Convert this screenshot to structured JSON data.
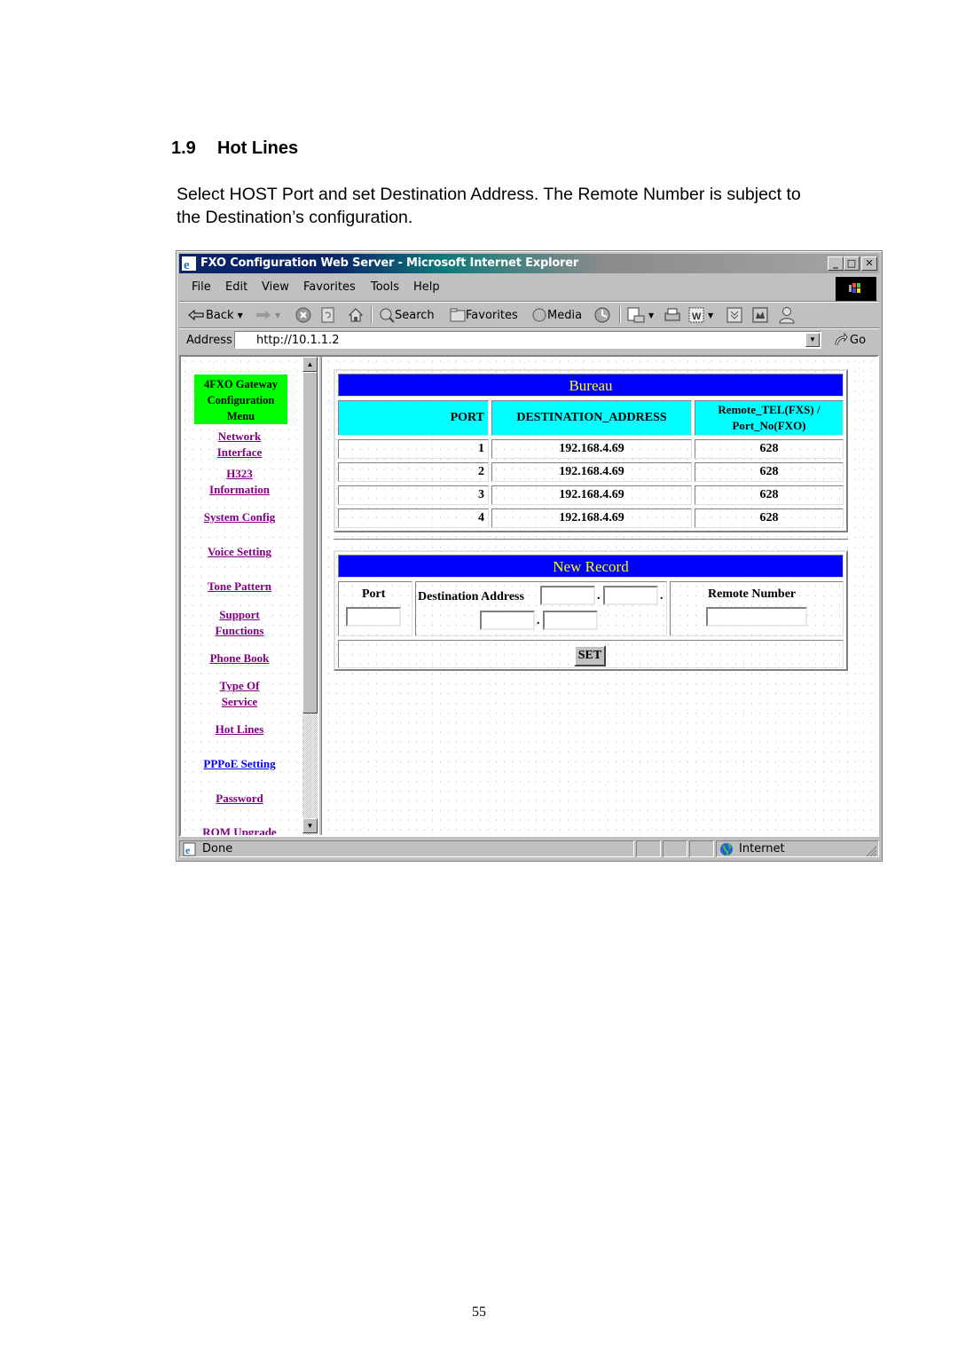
{
  "document": {
    "section_number": "1.9",
    "section_title": "Hot Lines",
    "paragraph": "Select HOST Port and set Destination Address. The Remote Number is subject to the Destination’s configuration.",
    "page_number": "55"
  },
  "browser": {
    "window_title": "FXO Configuration Web Server - Microsoft Internet Explorer",
    "window_controls": {
      "minimize": "_",
      "maximize": "□",
      "close": "✕"
    },
    "menu": [
      "File",
      "Edit",
      "View",
      "Favorites",
      "Tools",
      "Help"
    ],
    "toolbar": {
      "back": "Back",
      "search": "Search",
      "favorites": "Favorites",
      "media": "Media",
      "icons": [
        "back-arrow-icon",
        "forward-arrow-icon",
        "stop-icon",
        "refresh-icon",
        "home-icon",
        "search-icon",
        "favorites-icon",
        "media-icon",
        "history-icon",
        "mail-icon",
        "print-icon",
        "edit-icon",
        "discuss-icon",
        "research-icon",
        "messenger-icon"
      ]
    },
    "address_label": "Address",
    "address_value": "http://10.1.1.2",
    "go_label": "Go",
    "status_text": "Done",
    "zone_text": "Internet"
  },
  "sidebar": {
    "header": [
      "4FXO Gateway",
      "Configuration",
      "Menu"
    ],
    "links": [
      {
        "label": "Network Interface",
        "lines": [
          "Network",
          "Interface"
        ]
      },
      {
        "label": "H323 Information",
        "lines": [
          "H323",
          "Information"
        ]
      },
      {
        "label": "System Config",
        "lines": [
          "System Config"
        ]
      },
      {
        "label": "Voice Setting",
        "lines": [
          "Voice Setting"
        ]
      },
      {
        "label": "Tone Pattern",
        "lines": [
          "Tone Pattern"
        ]
      },
      {
        "label": "Support Functions",
        "lines": [
          "Support",
          "Functions"
        ]
      },
      {
        "label": "Phone Book",
        "lines": [
          "Phone Book"
        ]
      },
      {
        "label": "Type Of Service",
        "lines": [
          "Type Of",
          "Service"
        ]
      },
      {
        "label": "Hot Lines",
        "lines": [
          "Hot Lines"
        ]
      },
      {
        "label": "PPPoE Setting",
        "lines": [
          "PPPoE Setting"
        ],
        "active": true
      },
      {
        "label": "Password",
        "lines": [
          "Password"
        ]
      },
      {
        "label": "ROM Upgrade",
        "lines": [
          "ROM Upgrade"
        ]
      }
    ]
  },
  "bureau": {
    "title": "Bureau",
    "columns": [
      "PORT",
      "DESTINATION_ADDRESS",
      "Remote_TEL(FXS) /",
      "Port_No(FXO)"
    ],
    "rows": [
      {
        "port": "1",
        "destination": "192.168.4.69",
        "remote": "628"
      },
      {
        "port": "2",
        "destination": "192.168.4.69",
        "remote": "628"
      },
      {
        "port": "3",
        "destination": "192.168.4.69",
        "remote": "628"
      },
      {
        "port": "4",
        "destination": "192.168.4.69",
        "remote": "628"
      }
    ]
  },
  "new_record": {
    "title": "New Record",
    "port_label": "Port",
    "port_value": "",
    "destination_label": "Destination Address",
    "destination_octets": [
      "",
      "",
      "",
      ""
    ],
    "remote_label": "Remote Number",
    "remote_value": "",
    "set_label": "SET"
  },
  "colors": {
    "title_bar_blue": "#0000ff",
    "title_text_yellow": "#ffff00",
    "header_cyan": "#00ffff",
    "menu_green": "#00ff00",
    "link_visited": "#800080",
    "link_active": "#0000ff"
  }
}
